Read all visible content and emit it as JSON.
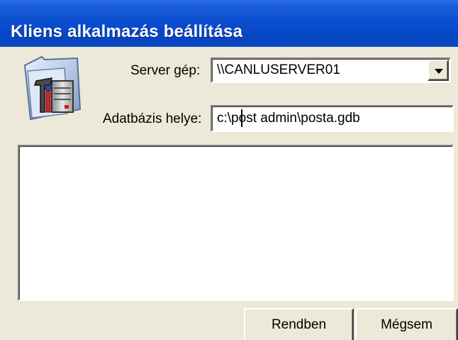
{
  "window": {
    "title": "Kliens alkalmazás beállítása"
  },
  "form": {
    "server_label": "Server gép:",
    "server_value": "\\\\CANLUSERVER01",
    "db_label": "Adatbázis helye:",
    "db_value": "c:\\post admin\\posta.gdb"
  },
  "buttons": {
    "ok": "Rendben",
    "cancel": "Mégsem"
  },
  "icons": {
    "app": "toolbox-folder-icon",
    "dropdown": "chevron-down-icon"
  }
}
